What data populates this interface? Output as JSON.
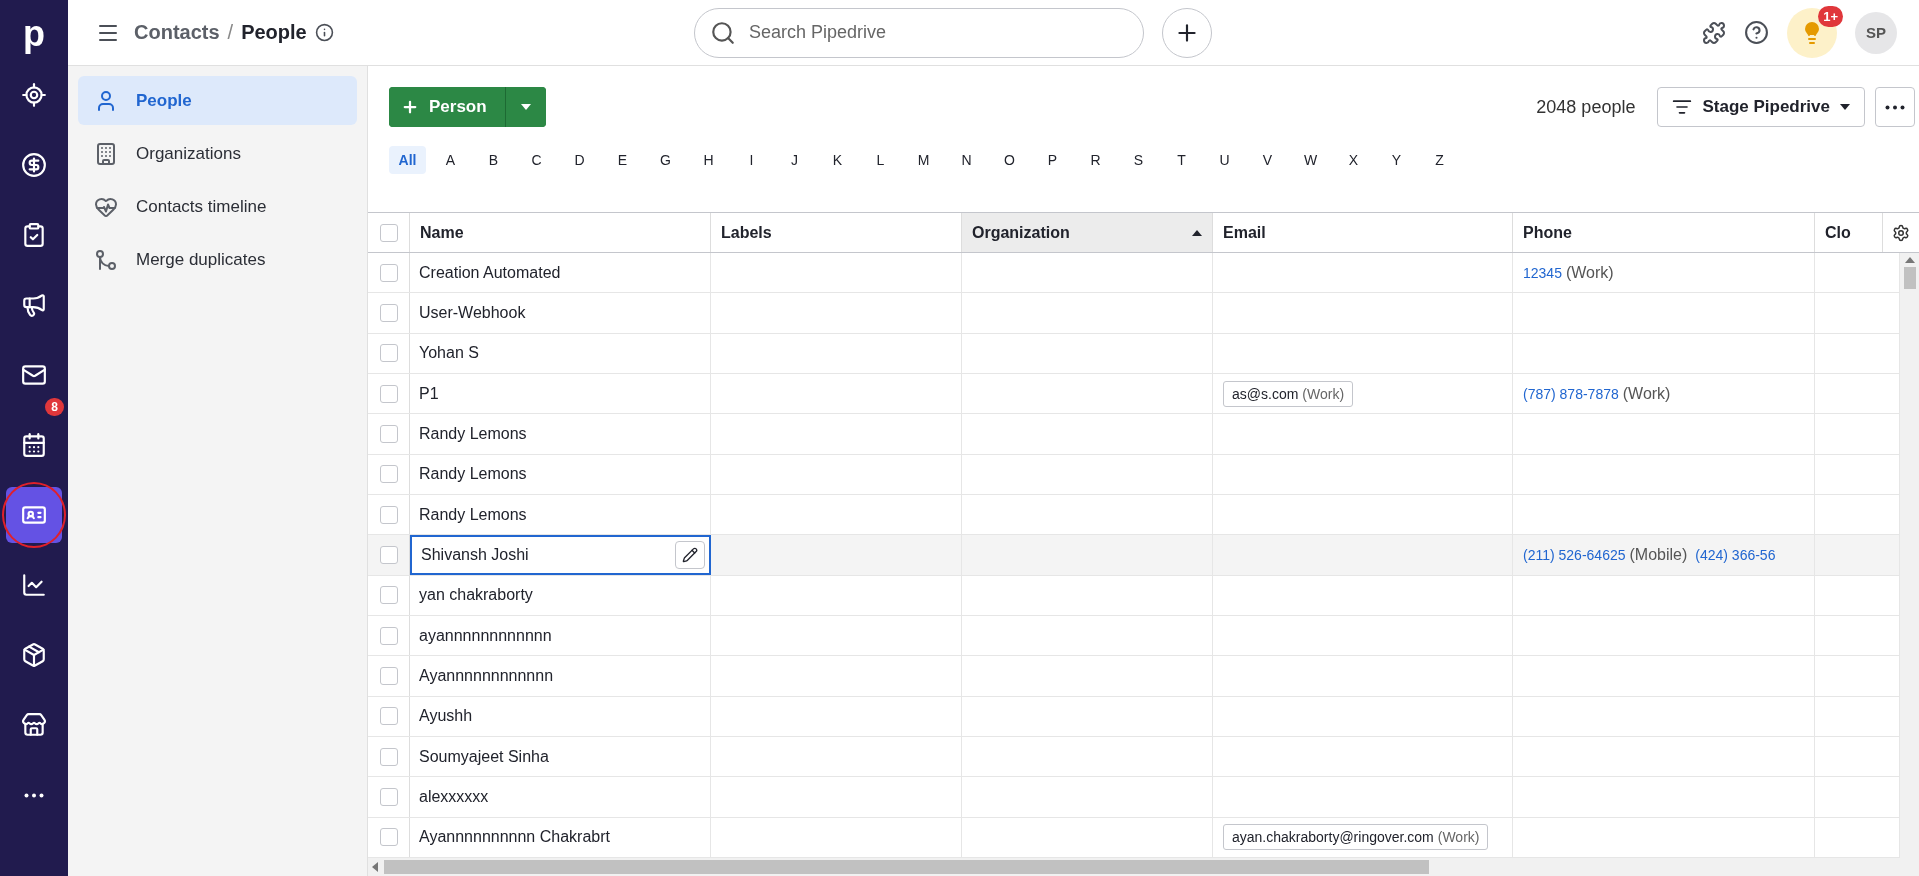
{
  "nav": {
    "logo": "p",
    "items": [
      {
        "selected": false
      },
      {
        "selected": false
      },
      {
        "selected": false
      },
      {
        "selected": false
      },
      {
        "selected": false
      },
      {
        "selected": false,
        "badge": "8"
      },
      {
        "selected": true,
        "annotated": true
      },
      {
        "selected": false
      },
      {
        "selected": false
      },
      {
        "selected": false
      }
    ]
  },
  "topbar": {
    "breadcrumb": [
      "Contacts",
      "People"
    ],
    "separator": "/",
    "search": {
      "placeholder": "Search Pipedrive"
    },
    "tips_badge": "1+",
    "avatar": "SP"
  },
  "sidebar": {
    "items": [
      {
        "label": "People",
        "selected": true
      },
      {
        "label": "Organizations",
        "selected": false
      },
      {
        "label": "Contacts timeline",
        "selected": false
      },
      {
        "label": "Merge duplicates",
        "selected": false
      }
    ]
  },
  "toolbar": {
    "add_button": "Person",
    "count": "2048 people",
    "filter": "Stage Pipedrive"
  },
  "alphabet": [
    {
      "label": "All",
      "selected": true
    },
    {
      "label": "A",
      "selected": false
    },
    {
      "label": "B",
      "selected": false
    },
    {
      "label": "C",
      "selected": false
    },
    {
      "label": "D",
      "selected": false
    },
    {
      "label": "E",
      "selected": false
    },
    {
      "label": "G",
      "selected": false
    },
    {
      "label": "H",
      "selected": false
    },
    {
      "label": "I",
      "selected": false
    },
    {
      "label": "J",
      "selected": false
    },
    {
      "label": "K",
      "selected": false
    },
    {
      "label": "L",
      "selected": false
    },
    {
      "label": "M",
      "selected": false
    },
    {
      "label": "N",
      "selected": false
    },
    {
      "label": "O",
      "selected": false
    },
    {
      "label": "P",
      "selected": false
    },
    {
      "label": "R",
      "selected": false
    },
    {
      "label": "S",
      "selected": false
    },
    {
      "label": "T",
      "selected": false
    },
    {
      "label": "U",
      "selected": false
    },
    {
      "label": "V",
      "selected": false
    },
    {
      "label": "W",
      "selected": false
    },
    {
      "label": "X",
      "selected": false
    },
    {
      "label": "Y",
      "selected": false
    },
    {
      "label": "Z",
      "selected": false
    }
  ],
  "table": {
    "all_checked": false,
    "columns": [
      {
        "label": "Name",
        "sorted": false
      },
      {
        "label": "Labels",
        "sorted": false
      },
      {
        "label": "Organization",
        "sorted": true
      },
      {
        "label": "Email",
        "sorted": false
      },
      {
        "label": "Phone",
        "sorted": false
      },
      {
        "label": "Clo",
        "sorted": false
      }
    ],
    "rows": [
      {
        "name": "Creation Automated",
        "checked": false,
        "editing": false,
        "phones": [
          {
            "number": "12345",
            "type": "(Work)"
          }
        ]
      },
      {
        "name": "User-Webhook",
        "checked": false,
        "editing": false
      },
      {
        "name": "Yohan S",
        "checked": false,
        "editing": false
      },
      {
        "name": "P1",
        "checked": false,
        "editing": false,
        "email": {
          "address": "as@s.com",
          "type": "(Work)"
        },
        "phones": [
          {
            "number": "(787) 878-7878",
            "type": "(Work)"
          }
        ]
      },
      {
        "name": "Randy Lemons",
        "checked": false,
        "editing": false
      },
      {
        "name": "Randy Lemons",
        "checked": false,
        "editing": false
      },
      {
        "name": "Randy Lemons",
        "checked": false,
        "editing": false
      },
      {
        "name": "Shivansh Joshi",
        "checked": false,
        "editing": true,
        "phones": [
          {
            "number": "(211) 526-64625",
            "type": "(Mobile)"
          },
          {
            "number": "(424) 366-56"
          }
        ]
      },
      {
        "name": "yan chakraborty",
        "checked": false,
        "editing": false
      },
      {
        "name": "ayannnnnnnnnnnn",
        "checked": false,
        "editing": false
      },
      {
        "name": "Ayannnnnnnnnnnn",
        "checked": false,
        "editing": false
      },
      {
        "name": "Ayushh",
        "checked": false,
        "editing": false
      },
      {
        "name": "Soumyajeet Sinha",
        "checked": false,
        "editing": false
      },
      {
        "name": "alexxxxxx",
        "checked": false,
        "editing": false
      },
      {
        "name": "Ayannnnnnnnnn Chakrabrt",
        "checked": false,
        "editing": false,
        "email": {
          "address": "ayan.chakraborty@ringover.com",
          "type": "(Work)"
        }
      }
    ]
  }
}
